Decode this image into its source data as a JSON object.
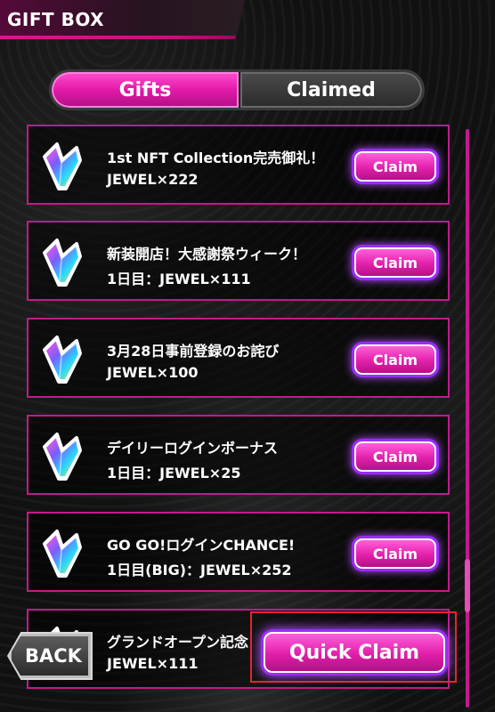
{
  "header": {
    "title": "GIFT BOX"
  },
  "tabs": [
    {
      "label": "Gifts",
      "active": true
    },
    {
      "label": "Claimed",
      "active": false
    }
  ],
  "gifts": [
    {
      "title": "1st NFT Collection完売御礼！",
      "reward": "JEWEL×222",
      "button": "Claim",
      "icon": "jewel-icon"
    },
    {
      "title": "新装開店！大感謝祭ウィーク！",
      "reward": "1日目：JEWEL×111",
      "button": "Claim",
      "icon": "jewel-icon"
    },
    {
      "title": "3月28日事前登録のお詫び",
      "reward": "JEWEL×100",
      "button": "Claim",
      "icon": "jewel-icon"
    },
    {
      "title": "デイリーログインボーナス",
      "reward": "1日目：JEWEL×25",
      "button": "Claim",
      "icon": "jewel-icon"
    },
    {
      "title": "GO GO!ログインCHANCE!",
      "reward": "1日目(BIG)：JEWEL×252",
      "button": "Claim",
      "icon": "jewel-icon"
    },
    {
      "title": "グランドオープン記念",
      "reward": "JEWEL×111",
      "button": "",
      "icon": "jewel-icon"
    }
  ],
  "footer": {
    "back_label": "BACK",
    "quick_claim_label": "Quick Claim"
  },
  "colors": {
    "accent": "#e21aa8",
    "card_border": "#c21a8e",
    "glow": "#9a2cff",
    "highlight_frame": "#e0282e"
  }
}
